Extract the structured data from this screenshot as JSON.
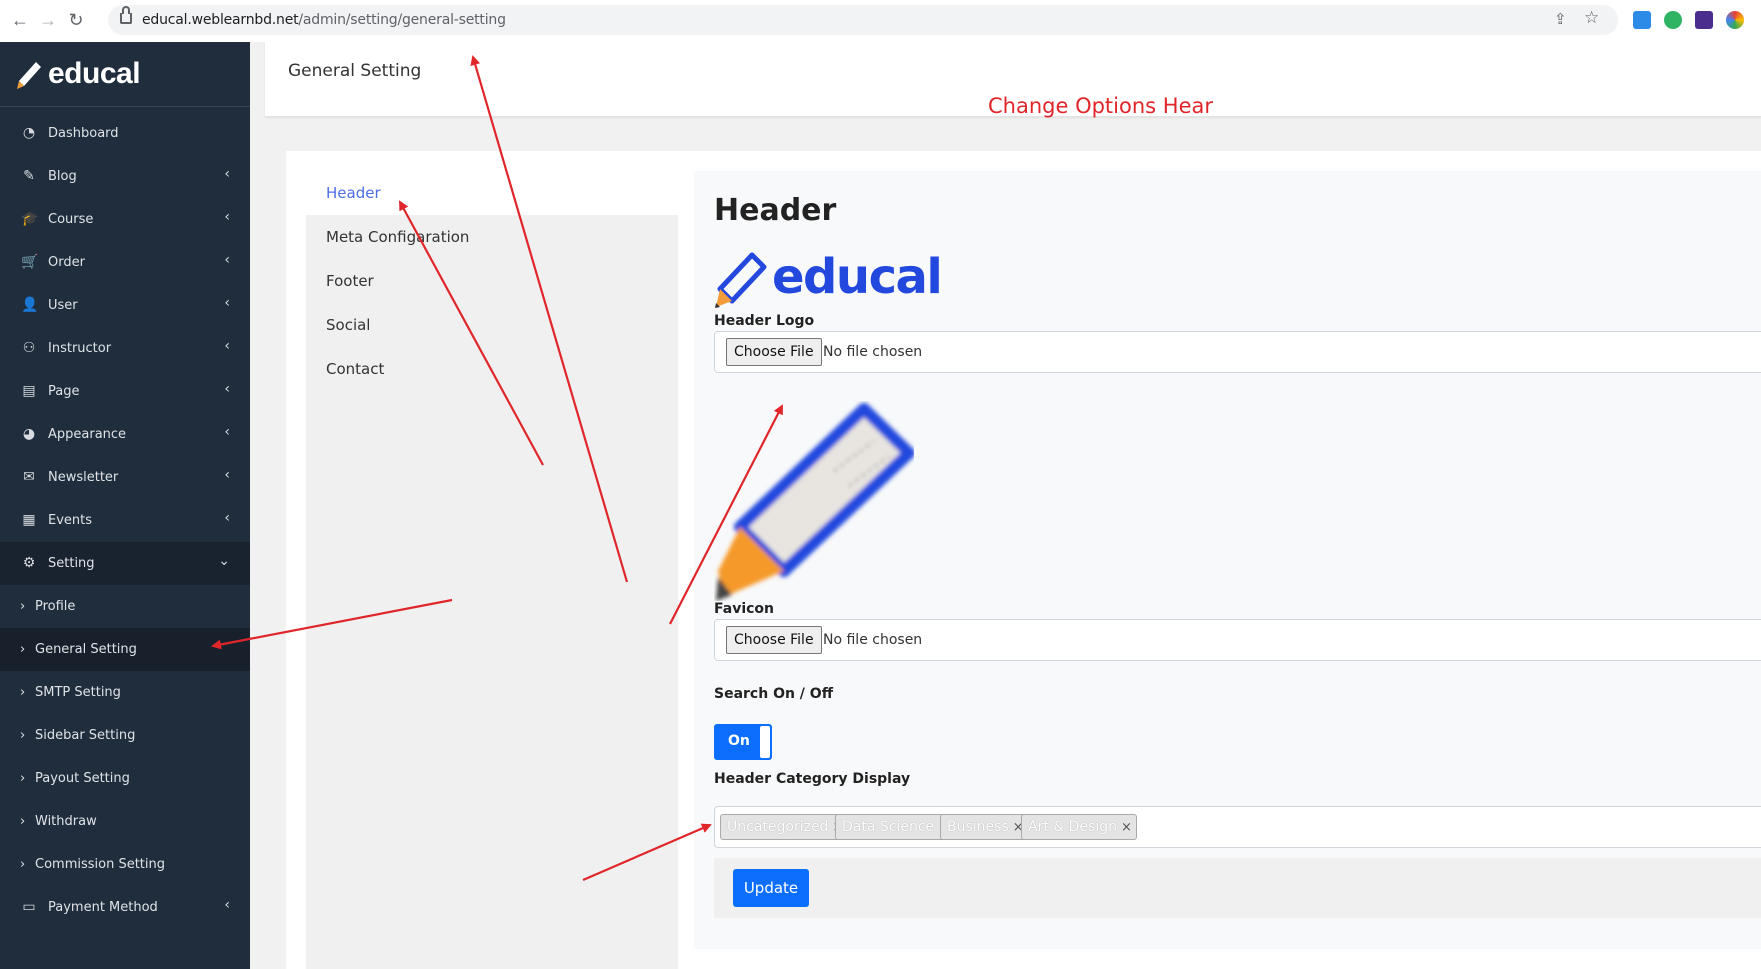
{
  "browser": {
    "url_host": "educal.weblearnbd.net",
    "url_path": "/admin/setting/general-setting"
  },
  "sidebar": {
    "brand": "educal",
    "items": [
      {
        "label": "Dashboard",
        "icon": "dashboard-icon",
        "caret": false
      },
      {
        "label": "Blog",
        "icon": "blog-icon",
        "caret": true
      },
      {
        "label": "Course",
        "icon": "graduation-cap-icon",
        "caret": true
      },
      {
        "label": "Order",
        "icon": "cart-icon",
        "caret": true
      },
      {
        "label": "User",
        "icon": "user-icon",
        "caret": true
      },
      {
        "label": "Instructor",
        "icon": "instructor-icon",
        "caret": true
      },
      {
        "label": "Page",
        "icon": "page-icon",
        "caret": true
      },
      {
        "label": "Appearance",
        "icon": "palette-icon",
        "caret": true
      },
      {
        "label": "Newsletter",
        "icon": "envelope-icon",
        "caret": true
      },
      {
        "label": "Events",
        "icon": "calendar-icon",
        "caret": true
      },
      {
        "label": "Setting",
        "icon": "gear-icon",
        "caret": true
      }
    ],
    "setting_sub": [
      {
        "label": "Profile"
      },
      {
        "label": "General Setting"
      },
      {
        "label": "SMTP Setting"
      },
      {
        "label": "Sidebar Setting"
      },
      {
        "label": "Payout Setting"
      },
      {
        "label": "Withdraw"
      },
      {
        "label": "Commission Setting"
      }
    ],
    "last_item": {
      "label": "Payment Method",
      "icon": "payment-card-icon"
    }
  },
  "page": {
    "title": "General Setting",
    "annotation": "Change Options Hear"
  },
  "tabs": [
    {
      "label": "Header"
    },
    {
      "label": "Meta Configaration"
    },
    {
      "label": "Footer"
    },
    {
      "label": "Social"
    },
    {
      "label": "Contact"
    }
  ],
  "panel": {
    "title": "Header",
    "logo_word": "educal",
    "header_logo_label": "Header Logo",
    "choose_file_label": "Choose File",
    "no_file_label": "No file chosen",
    "favicon_label": "Favicon",
    "search_label": "Search On / Off",
    "toggle_label": "On",
    "category_label": "Header Category Display",
    "tags": [
      "Uncategorized",
      "Data Science",
      "Business",
      "Art & Design"
    ],
    "tag_remove": "×",
    "update_label": "Update"
  },
  "colors": {
    "sidebar_bg": "#1f2d3d",
    "accent": "#0d6efd",
    "active_tab": "#4e6ee6",
    "annotation": "#e0262a"
  }
}
